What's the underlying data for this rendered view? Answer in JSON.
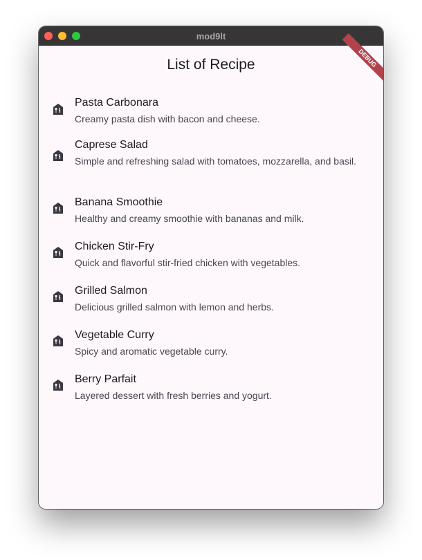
{
  "window": {
    "title": "mod9lt"
  },
  "app": {
    "title": "List of Recipe",
    "debug_banner": "DEBUG",
    "icon": "restaurant-home-icon",
    "background": "#fef7fc"
  },
  "recipes": [
    {
      "name": "Pasta Carbonara",
      "description": "Creamy pasta dish with bacon and cheese."
    },
    {
      "name": "Caprese Salad",
      "description": "Simple and refreshing salad with tomatoes, mozzarella, and basil."
    },
    {
      "name": "Banana Smoothie",
      "description": "Healthy and creamy smoothie with bananas and milk."
    },
    {
      "name": "Chicken Stir-Fry",
      "description": "Quick and flavorful stir-fried chicken with vegetables."
    },
    {
      "name": "Grilled Salmon",
      "description": "Delicious grilled salmon with lemon and herbs."
    },
    {
      "name": "Vegetable Curry",
      "description": "Spicy and aromatic vegetable curry."
    },
    {
      "name": "Berry Parfait",
      "description": "Layered dessert with fresh berries and yogurt."
    }
  ]
}
